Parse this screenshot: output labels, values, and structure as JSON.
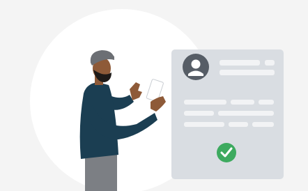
{
  "illustration": {
    "colors": {
      "page_background": "#f4f4f4",
      "backdrop_circle": "#ffffff",
      "card": "#d9dde2",
      "placeholder_line": "#f2f3f5",
      "avatar_circle": "#565d66",
      "avatar_figure": "#ffffff",
      "check_badge": "#3daa5f",
      "check_mark": "#ffffff",
      "jacket": "#1b3e52",
      "skin": "#8e5a38",
      "beard": "#1e1a18",
      "cap": "#6c6f74",
      "trousers": "#7c7f84",
      "phone": "#ffffff"
    },
    "icons": {
      "avatar": "user-avatar-icon",
      "check": "check-circle-icon",
      "phone": "smartphone-icon"
    }
  }
}
